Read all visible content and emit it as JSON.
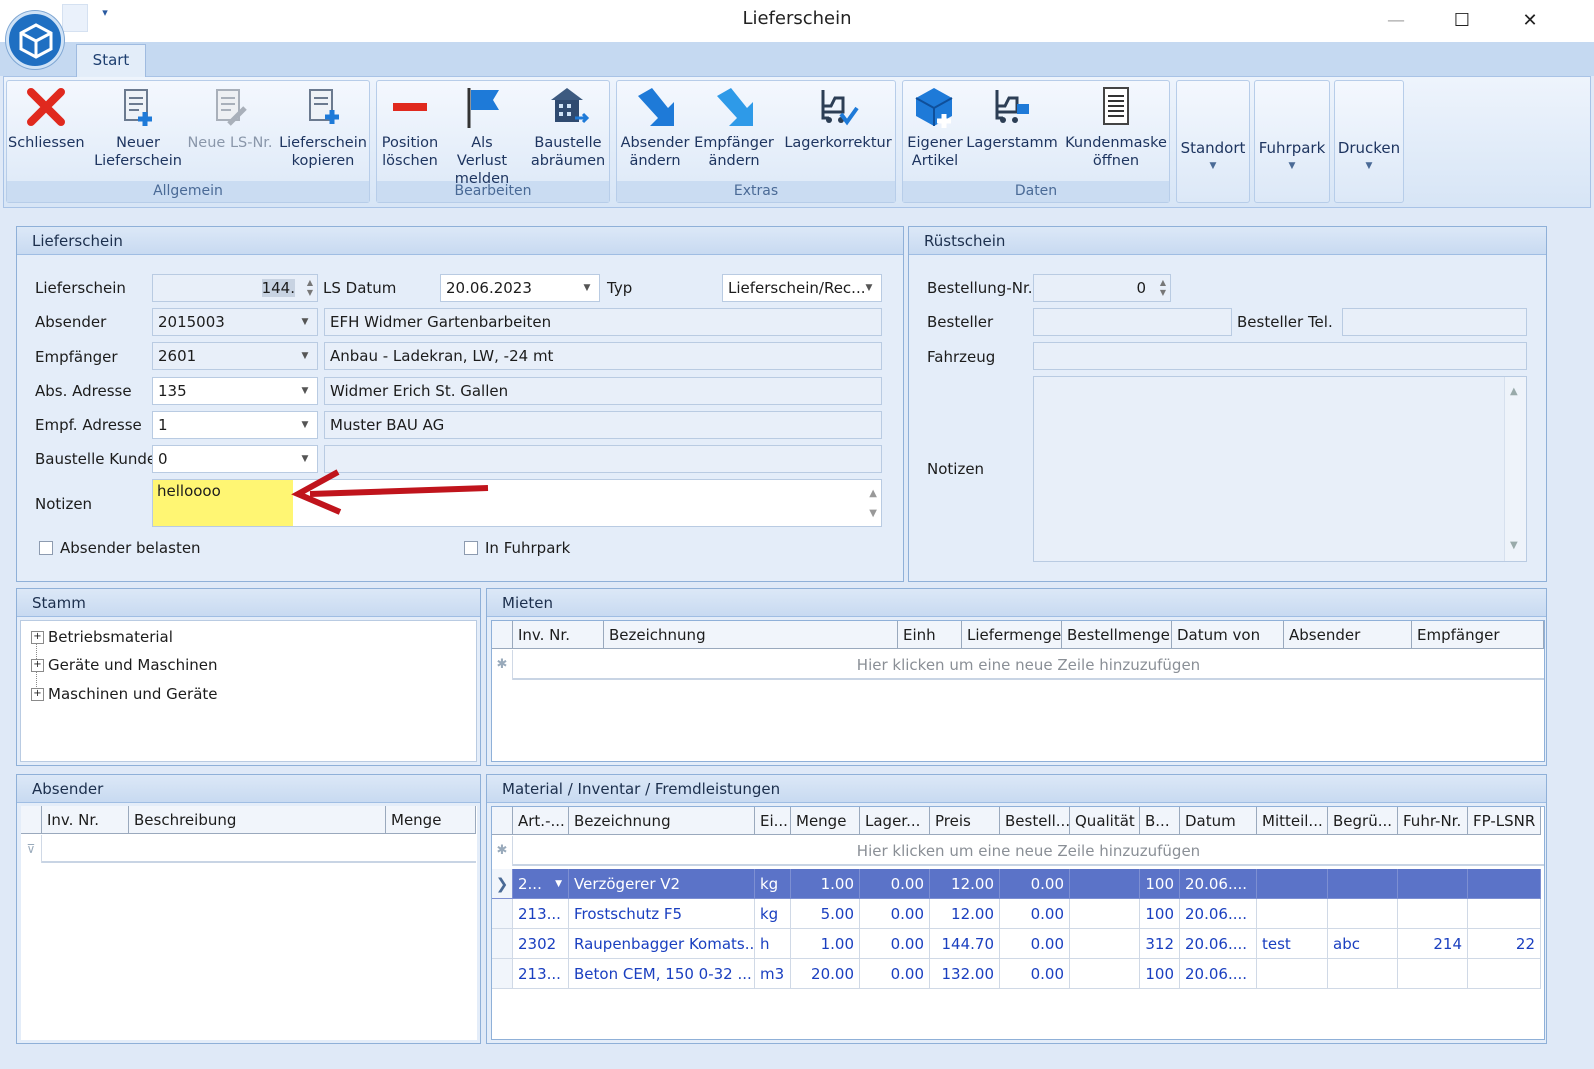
{
  "window": {
    "title": "Lieferschein",
    "minimize": "—",
    "maximize": "☐",
    "close": "✕"
  },
  "ribbon": {
    "tab": "Start",
    "groups": {
      "allgemein": "Allgemein",
      "bearbeiten": "Bearbeiten",
      "extras": "Extras",
      "daten": "Daten"
    },
    "buttons": {
      "schliessen": "Schliessen",
      "neuer_lieferschein_1": "Neuer",
      "neuer_lieferschein_2": "Lieferschein",
      "neue_ls_nr": "Neue LS-Nr.",
      "kopieren_1": "Lieferschein",
      "kopieren_2": "kopieren",
      "position_1": "Position",
      "position_2": "löschen",
      "verlust_1": "Als Verlust",
      "verlust_2": "melden",
      "baustelle_1": "Baustelle",
      "baustelle_2": "abräumen",
      "absender_1": "Absender",
      "absender_2": "ändern",
      "empfaenger_1": "Empfänger",
      "empfaenger_2": "ändern",
      "lagerkorrektur": "Lagerkorrektur",
      "eigener_1": "Eigener",
      "eigener_2": "Artikel",
      "lagerstamm": "Lagerstamm",
      "kundenmaske_1": "Kundenmaske",
      "kundenmaske_2": "öffnen",
      "standort": "Standort",
      "fuhrpark": "Fuhrpark",
      "drucken": "Drucken"
    }
  },
  "lieferschein": {
    "title": "Lieferschein",
    "labels": {
      "lieferschein": "Lieferschein",
      "ls_datum": "LS Datum",
      "typ": "Typ",
      "absender": "Absender",
      "empfaenger": "Empfänger",
      "abs_adresse": "Abs. Adresse",
      "empf_adresse": "Empf. Adresse",
      "baustelle_kunde": "Baustelle Kunde",
      "notizen": "Notizen",
      "absender_belasten": "Absender belasten",
      "in_fuhrpark": "In Fuhrpark"
    },
    "values": {
      "lieferschein": "144.",
      "ls_datum": "20.06.2023",
      "typ": "Lieferschein/Rec...",
      "absender_nr": "2015003",
      "absender_name": "EFH Widmer Gartenbarbeiten",
      "empfaenger_nr": "2601",
      "empfaenger_name": "Anbau - Ladekran, LW, -24 mt",
      "abs_adresse_nr": "135",
      "abs_adresse_name": "Widmer Erich St. Gallen",
      "empf_adresse_nr": "1",
      "empf_adresse_name": "Muster BAU AG",
      "baustelle_kunde_nr": "0",
      "baustelle_kunde_name": "",
      "notizen": "helloooo"
    }
  },
  "ruestschein": {
    "title": "Rüstschein",
    "labels": {
      "bestellung_nr": "Bestellung-Nr.",
      "besteller": "Besteller",
      "besteller_tel": "Besteller Tel.",
      "fahrzeug": "Fahrzeug",
      "notizen": "Notizen"
    },
    "values": {
      "bestellung_nr": "0"
    }
  },
  "stamm": {
    "title": "Stamm",
    "items": [
      "Betriebsmaterial",
      "Geräte und Maschinen",
      "Maschinen und Geräte"
    ]
  },
  "mieten": {
    "title": "Mieten",
    "columns": [
      "Inv. Nr.",
      "Bezeichnung",
      "Einh",
      "Liefermenge",
      "Bestellmenge",
      "Datum von",
      "Absender",
      "Empfänger"
    ],
    "new_row": "Hier klicken um eine neue Zeile hinzuzufügen"
  },
  "absender_panel": {
    "title": "Absender",
    "columns": [
      "Inv. Nr.",
      "Beschreibung",
      "Menge"
    ]
  },
  "material": {
    "title": "Material / Inventar / Fremdleistungen",
    "columns": [
      "Art.-...",
      "Bezeichnung",
      "Ei...",
      "Menge",
      "Lager...",
      "Preis",
      "Bestell...",
      "Qualität",
      "B...",
      "Datum",
      "Mitteil...",
      "Begrü...",
      "Fuhr-Nr.",
      "FP-LSNR"
    ],
    "new_row": "Hier klicken um eine neue Zeile hinzuzufügen",
    "rows": [
      [
        "2...",
        "Verzögerer V2",
        "kg",
        "1.00",
        "0.00",
        "12.00",
        "0.00",
        "",
        "100",
        "20.06....",
        "",
        "",
        "",
        ""
      ],
      [
        "213...",
        "Frostschutz F5",
        "kg",
        "5.00",
        "0.00",
        "12.00",
        "0.00",
        "",
        "100",
        "20.06....",
        "",
        "",
        "",
        ""
      ],
      [
        "2302",
        "Raupenbagger Komats...",
        "h",
        "1.00",
        "0.00",
        "144.70",
        "0.00",
        "",
        "312",
        "20.06....",
        "test",
        "abc",
        "214",
        "22"
      ],
      [
        "213...",
        "Beton CEM, 150 0-32 ...",
        "m3",
        "20.00",
        "0.00",
        "132.00",
        "0.00",
        "",
        "100",
        "20.06....",
        "",
        "",
        "",
        ""
      ]
    ]
  },
  "colors": {
    "accent": "#1f6fc2",
    "selected_row": "#5b73c8",
    "highlight": "#fff45a",
    "arrow": "#c0141c"
  }
}
